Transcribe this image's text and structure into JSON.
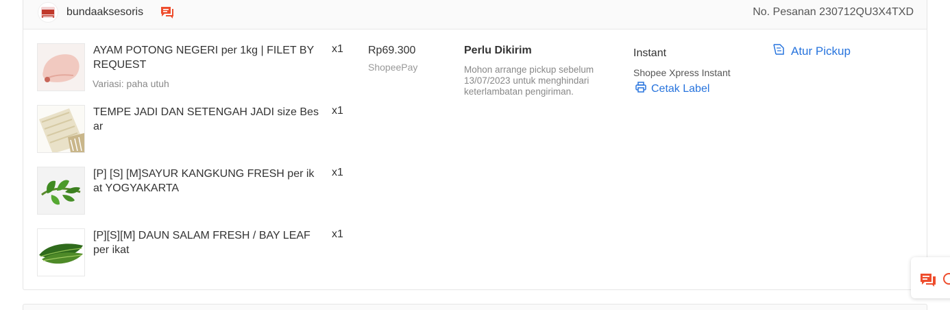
{
  "order": {
    "shop_name": "bundaaksesoris",
    "shop_logo_text": "bunda",
    "order_number": "No. Pesanan 230712QU3X4TXD",
    "price": "Rp69.300",
    "payment_method": "ShopeePay",
    "status": "Perlu Dikirim",
    "status_note": "Mohon arrange pickup sebelum 13/07/2023 untuk menghindari keterlambatan pengiriman.",
    "shipping_type": "Instant",
    "courier": "Shopee Xpress Instant",
    "print_label": "Cetak Label",
    "pickup_label": "Atur Pickup",
    "products": [
      {
        "name": "AYAM POTONG NEGERI per 1kg | FILET BY REQUEST",
        "variant": "Variasi: paha utuh",
        "qty": "x1"
      },
      {
        "name": "TEMPE JADI DAN SETENGAH JADI size Besar",
        "variant": "",
        "qty": "x1"
      },
      {
        "name": "[P] [S] [M]SAYUR KANGKUNG FRESH per ikat YOGYAKARTA",
        "variant": "",
        "qty": "x1"
      },
      {
        "name": "[P][S][M] DAUN SALAM FRESH / BAY LEAF per ikat",
        "variant": "",
        "qty": "x1"
      }
    ]
  },
  "colors": {
    "link": "#2673dd",
    "brand": "#ee4d2d"
  },
  "icons": [
    "chat-icon",
    "printer-icon",
    "pickup-icon",
    "floating-chat-icon"
  ]
}
